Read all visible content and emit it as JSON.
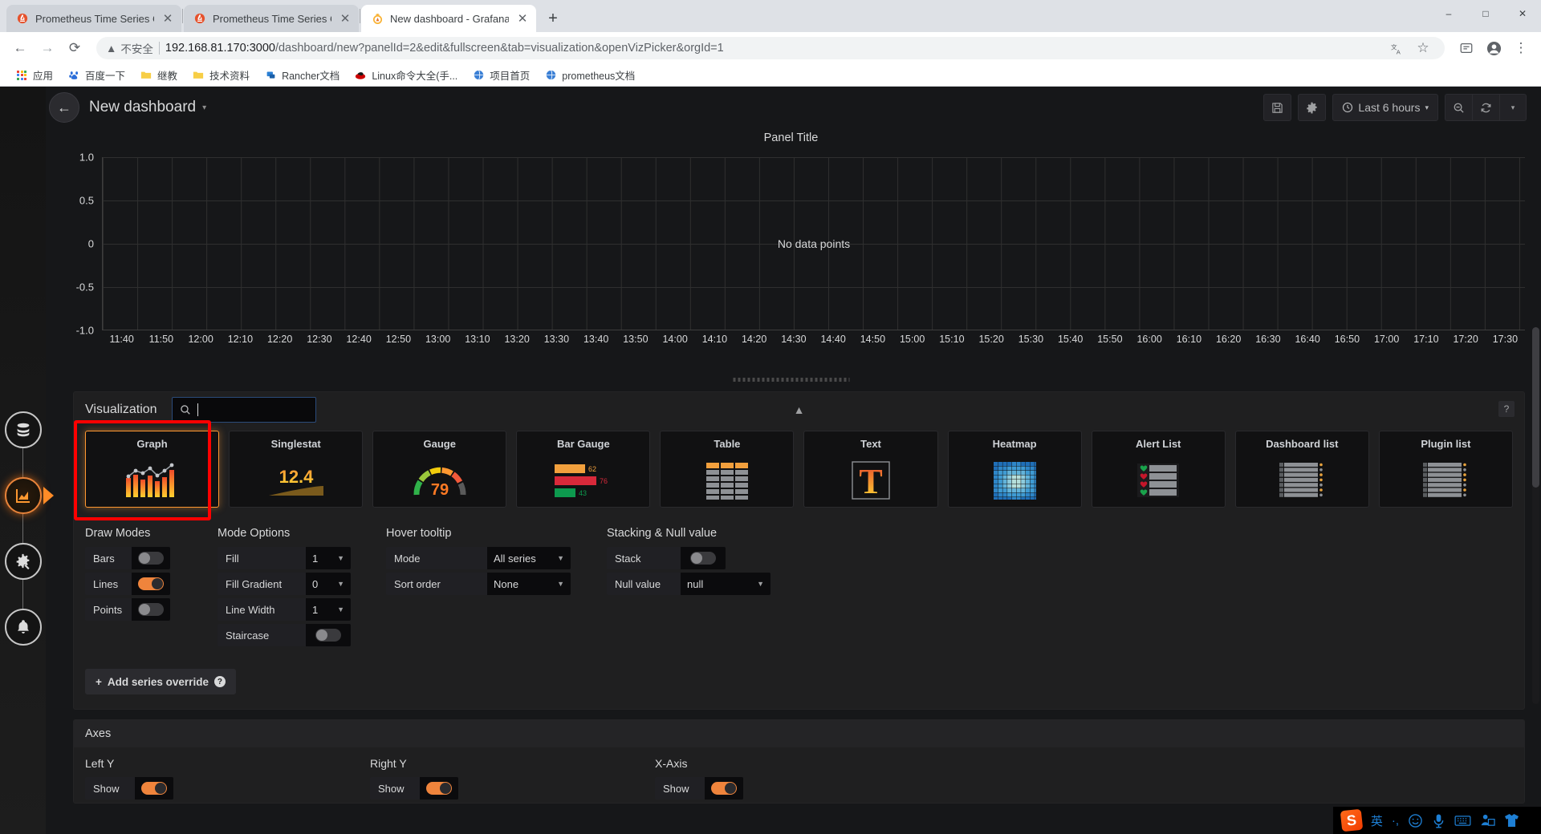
{
  "browser": {
    "tabs": [
      {
        "title": "Prometheus Time Series Colle",
        "favicon": "prometheus-icon",
        "active": false
      },
      {
        "title": "Prometheus Time Series Colle",
        "favicon": "prometheus-icon",
        "active": false
      },
      {
        "title": "New dashboard - Grafana",
        "favicon": "grafana-icon",
        "active": true
      }
    ],
    "new_tab_label": "+",
    "window_controls": {
      "minimize": "–",
      "maximize": "□",
      "close": "✕"
    },
    "nav": {
      "back": "←",
      "forward": "→",
      "reload": "⟳",
      "security_label": "不安全",
      "security_icon": "warning-triangle-icon",
      "url_host": "192.168.81.170:3000",
      "url_rest": "/dashboard/new?panelId=2&edit&fullscreen&tab=visualization&openVizPicker&orgId=1",
      "url_full": "192.168.81.170:3000/dashboard/new?panelId=2&edit&fullscreen&tab=visualization&openVizPicker&orgId=1",
      "translate_icon": "translate-icon",
      "bookmark_icon": "star-icon",
      "extensions_icon": "extensions-icon",
      "profile_icon": "profile-avatar-icon",
      "menu_icon": "kebab-menu-icon"
    },
    "bookmarks": [
      {
        "label": "应用",
        "icon": "apps-grid-icon"
      },
      {
        "label": "百度一下",
        "icon": "baidu-icon"
      },
      {
        "label": "继教",
        "icon": "folder-icon"
      },
      {
        "label": "技术资料",
        "icon": "folder-icon"
      },
      {
        "label": "Rancher文档",
        "icon": "rancher-icon"
      },
      {
        "label": "Linux命令大全(手...",
        "icon": "redhat-icon"
      },
      {
        "label": "项目首页",
        "icon": "globe-icon"
      },
      {
        "label": "prometheus文档",
        "icon": "globe-icon"
      }
    ]
  },
  "grafana": {
    "sidebar": [
      {
        "name": "datasource-icon",
        "label": "Queries",
        "active": false
      },
      {
        "name": "visualization-icon",
        "label": "Visualization",
        "active": true
      },
      {
        "name": "general-settings-icon",
        "label": "General",
        "active": false
      },
      {
        "name": "alert-bell-icon",
        "label": "Alert",
        "active": false
      }
    ],
    "header": {
      "back_icon": "back-arrow-icon",
      "title": "New dashboard",
      "title_caret": "▾",
      "save_icon": "save-disk-icon",
      "settings_icon": "gear-icon",
      "time_range": "Last 6 hours",
      "time_icon": "clock-icon",
      "time_caret": "▾",
      "zoom_out_icon": "zoom-out-icon",
      "refresh_icon": "refresh-icon",
      "refresh_caret": "▾"
    },
    "panel": {
      "title": "Panel Title",
      "no_data_text": "No data points"
    },
    "visualization": {
      "section_label": "Visualization",
      "search_placeholder": "",
      "search_value": "",
      "search_icon": "search-icon",
      "collapse_icon": "chevron-up-icon",
      "help_icon": "question-mark-icon",
      "types": [
        {
          "name": "Graph",
          "icon": "graph-icon",
          "selected": true
        },
        {
          "name": "Singlestat",
          "icon": "singlestat-icon",
          "value": "12.4",
          "selected": false
        },
        {
          "name": "Gauge",
          "icon": "gauge-icon",
          "value": "79",
          "selected": false
        },
        {
          "name": "Bar Gauge",
          "icon": "bargauge-icon",
          "values": [
            "62",
            "76",
            "43"
          ],
          "selected": false
        },
        {
          "name": "Table",
          "icon": "table-icon",
          "selected": false
        },
        {
          "name": "Text",
          "icon": "text-icon",
          "glyph": "T",
          "selected": false
        },
        {
          "name": "Heatmap",
          "icon": "heatmap-icon",
          "selected": false
        },
        {
          "name": "Alert List",
          "icon": "alertlist-icon",
          "selected": false
        },
        {
          "name": "Dashboard list",
          "icon": "dashboardlist-icon",
          "selected": false
        },
        {
          "name": "Plugin list",
          "icon": "pluginlist-icon",
          "selected": false
        }
      ]
    },
    "options": {
      "draw_modes": {
        "title": "Draw Modes",
        "rows": [
          {
            "label": "Bars",
            "type": "toggle",
            "on": false
          },
          {
            "label": "Lines",
            "type": "toggle",
            "on": true
          },
          {
            "label": "Points",
            "type": "toggle",
            "on": false
          }
        ]
      },
      "mode_options": {
        "title": "Mode Options",
        "rows": [
          {
            "label": "Fill",
            "type": "select",
            "value": "1"
          },
          {
            "label": "Fill Gradient",
            "type": "select",
            "value": "0"
          },
          {
            "label": "Line Width",
            "type": "select",
            "value": "1"
          },
          {
            "label": "Staircase",
            "type": "toggle",
            "on": false
          }
        ]
      },
      "hover_tooltip": {
        "title": "Hover tooltip",
        "rows": [
          {
            "label": "Mode",
            "type": "select",
            "value": "All series"
          },
          {
            "label": "Sort order",
            "type": "select",
            "value": "None"
          }
        ]
      },
      "stacking": {
        "title": "Stacking & Null value",
        "rows": [
          {
            "label": "Stack",
            "type": "toggle",
            "on": false
          },
          {
            "label": "Null value",
            "type": "select",
            "value": "null"
          }
        ]
      },
      "add_series_override": {
        "label": "Add series override",
        "plus": "+",
        "help": "?"
      }
    },
    "axes": {
      "title": "Axes",
      "columns": [
        {
          "title": "Left Y",
          "rows": [
            {
              "label": "Show",
              "type": "toggle",
              "on": true
            }
          ]
        },
        {
          "title": "Right Y",
          "rows": [
            {
              "label": "Show",
              "type": "toggle",
              "on": true
            }
          ]
        },
        {
          "title": "X-Axis",
          "rows": [
            {
              "label": "Show",
              "type": "toggle",
              "on": true
            }
          ]
        }
      ]
    }
  },
  "chart_data": {
    "type": "line",
    "title": "Panel Title",
    "xlabel": "",
    "ylabel": "",
    "series": [],
    "annotation": "No data points",
    "grid": true,
    "legend": "none",
    "ylim": [
      -1.0,
      1.0
    ],
    "y_ticks": [
      "1.0",
      "0.5",
      "0",
      "-0.5",
      "-1.0"
    ],
    "y_tick_values": [
      1.0,
      0.5,
      0,
      -0.5,
      -1.0
    ],
    "x_ticks": [
      "11:40",
      "11:50",
      "12:00",
      "12:10",
      "12:20",
      "12:30",
      "12:40",
      "12:50",
      "13:00",
      "13:10",
      "13:20",
      "13:30",
      "13:40",
      "13:50",
      "14:00",
      "14:10",
      "14:20",
      "14:30",
      "14:40",
      "14:50",
      "15:00",
      "15:10",
      "15:20",
      "15:30",
      "15:40",
      "15:50",
      "16:00",
      "16:10",
      "16:20",
      "16:30",
      "16:40",
      "16:50",
      "17:00",
      "17:10",
      "17:20",
      "17:30"
    ]
  },
  "taskbar": {
    "ime": [
      {
        "name": "sogou-logo-icon",
        "glyph": "S"
      },
      {
        "name": "chinese-english-toggle-icon",
        "glyph": "英"
      },
      {
        "name": "punctuation-icon",
        "glyph": "·,"
      },
      {
        "name": "emoji-icon",
        "glyph": "☺"
      },
      {
        "name": "microphone-icon",
        "glyph": "🎤"
      },
      {
        "name": "keyboard-icon",
        "glyph": "⌨"
      },
      {
        "name": "user-toolbox-icon",
        "glyph": "⌘"
      },
      {
        "name": "skin-shirt-icon",
        "glyph": "👕"
      },
      {
        "name": "toolbox-grid-icon",
        "glyph": "▒"
      }
    ]
  },
  "colors": {
    "accent_orange": "#ff9830",
    "selection_red": "#ff0000",
    "panel_bg": "#1f1f20",
    "page_bg": "#161719",
    "text": "#d8d9da"
  }
}
